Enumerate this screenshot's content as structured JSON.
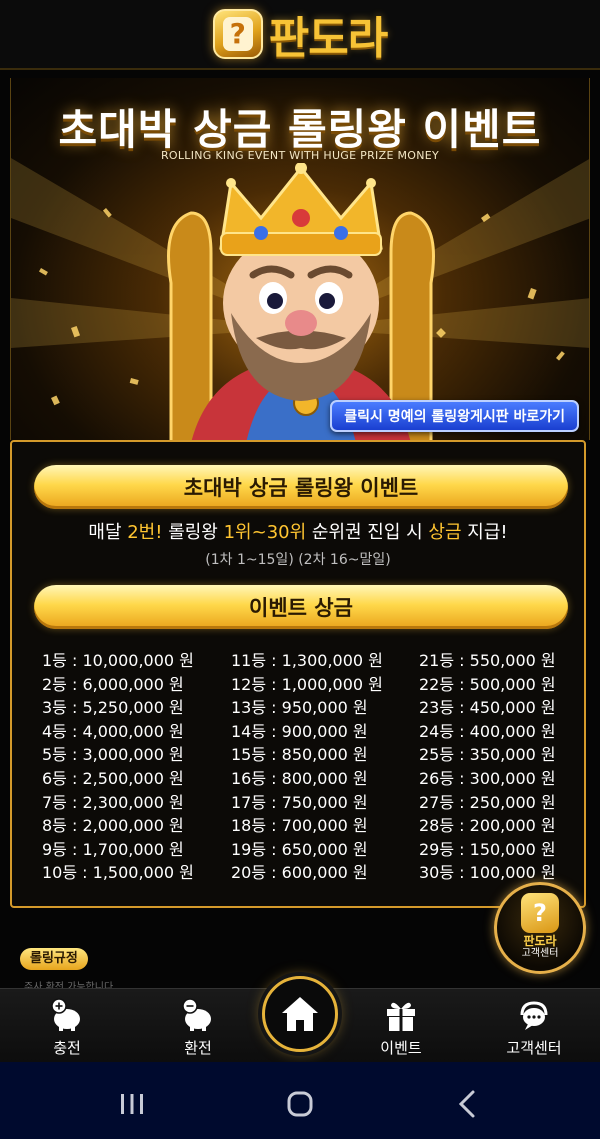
{
  "header": {
    "logo_mark": "?",
    "logo_text": "판도라"
  },
  "banner": {
    "title": "초대박 상금 롤링왕 이벤트",
    "subtitle": "ROLLING KING EVENT WITH HUGE PRIZE MONEY",
    "board_link": "클릭시 명예의 롤링왕게시판 바로가기"
  },
  "event": {
    "title": "초대박 상금 롤링왕 이벤트",
    "desc_parts": [
      "매달 ",
      "2번!",
      " 롤링왕 ",
      "1위~30위",
      " 순위권 진입 시 ",
      "상금",
      " 지급!"
    ],
    "schedule": "(1차 1~15일) (2차 16~말일)",
    "prize_title": "이벤트 상금"
  },
  "prizes": {
    "col1": [
      "1등 : 10,000,000 원",
      "2등 : 6,000,000 원",
      "3등 : 5,250,000 원",
      "4등 : 4,000,000 원",
      "5등 : 3,000,000 원",
      "6등 : 2,500,000 원",
      "7등 : 2,300,000 원",
      "8등 : 2,000,000 원",
      "9등 : 1,700,000 원",
      "10등 : 1,500,000 원"
    ],
    "col2": [
      "11등 : 1,300,000 원",
      "12등 : 1,000,000 원",
      "13등 : 950,000 원",
      "14등 : 900,000 원",
      "15등 : 850,000 원",
      "16등 : 800,000 원",
      "17등 : 750,000 원",
      "18등 : 700,000 원",
      "19등 : 650,000 원",
      "20등 : 600,000 원"
    ],
    "col3": [
      "21등 : 550,000 원",
      "22등 : 500,000 원",
      "23등 : 450,000 원",
      "24등 : 400,000 원",
      "25등 : 350,000 원",
      "26등 : 300,000 원",
      "27등 : 250,000 원",
      "28등 : 200,000 원",
      "29등 : 150,000 원",
      "30등 : 100,000 원"
    ]
  },
  "cs_float": {
    "mark": "?",
    "name": "판도라",
    "sub": "고객센터"
  },
  "rule": {
    "tag": "롤링규정",
    "text": "주사 환전 가능합니다."
  },
  "nav": {
    "charge": "충전",
    "exchange": "환전",
    "event": "이벤트",
    "support": "고객센터"
  },
  "colors": {
    "gold": "#f7c336",
    "highlight": "#ffc531",
    "panel_border": "#d49a2b",
    "link_blue": "#2a55e6"
  }
}
